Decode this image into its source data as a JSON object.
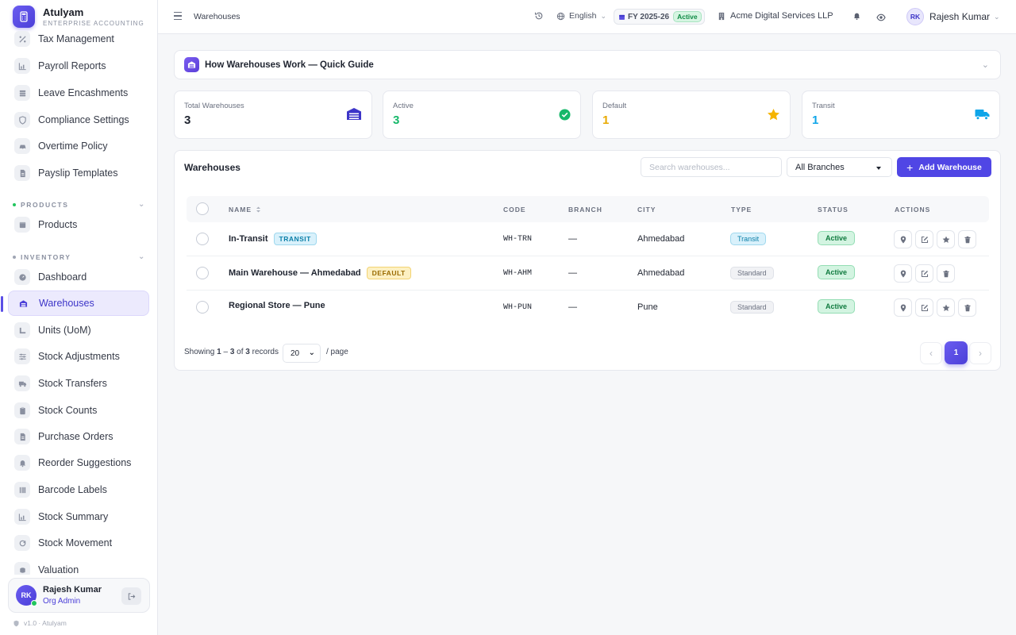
{
  "brand": {
    "name": "Atulyam",
    "subtitle": "ENTERPRISE ACCOUNTING"
  },
  "sidebar": {
    "items_top": [
      {
        "label": "Tax Management",
        "icon": "percent-icon"
      },
      {
        "label": "Payroll Reports",
        "icon": "chart-icon"
      },
      {
        "label": "Leave Encashments",
        "icon": "stack-icon"
      },
      {
        "label": "Compliance Settings",
        "icon": "shield-icon"
      },
      {
        "label": "Overtime Policy",
        "icon": "car-icon"
      },
      {
        "label": "Payslip Templates",
        "icon": "document-icon"
      }
    ],
    "section_products": {
      "label": "PRODUCTS",
      "dot_color": "#22c55e"
    },
    "products_items": [
      {
        "label": "Products",
        "icon": "box-icon"
      }
    ],
    "section_inventory": {
      "label": "INVENTORY",
      "dot_color": "#a0a6b4"
    },
    "inventory_items": [
      {
        "label": "Dashboard",
        "icon": "gauge-icon"
      },
      {
        "label": "Warehouses",
        "icon": "warehouse-icon",
        "active": true
      },
      {
        "label": "Units (UoM)",
        "icon": "ruler-icon"
      },
      {
        "label": "Stock Adjustments",
        "icon": "sliders-icon"
      },
      {
        "label": "Stock Transfers",
        "icon": "truck-icon"
      },
      {
        "label": "Stock Counts",
        "icon": "clipboard-icon"
      },
      {
        "label": "Purchase Orders",
        "icon": "document-icon"
      },
      {
        "label": "Reorder Suggestions",
        "icon": "bell-icon"
      },
      {
        "label": "Barcode Labels",
        "icon": "barcode-icon"
      },
      {
        "label": "Stock Summary",
        "icon": "chart-icon"
      },
      {
        "label": "Stock Movement",
        "icon": "cycle-icon"
      },
      {
        "label": "Valuation",
        "icon": "coins-icon"
      }
    ],
    "user": {
      "initials": "RK",
      "name": "Rajesh Kumar",
      "role": "Org Admin"
    },
    "version": "v1.0 · Atulyam"
  },
  "header": {
    "breadcrumb": "Warehouses",
    "language": "English",
    "fiscal_year": "FY 2025-26",
    "fiscal_status": "Active",
    "organization": "Acme Digital Services LLP",
    "user_initials": "RK",
    "user_name": "Rajesh Kumar"
  },
  "guide": {
    "title": "How Warehouses Work — Quick Guide"
  },
  "stats": [
    {
      "label": "Total Warehouses",
      "value": "3",
      "color": "#1f2430",
      "icon": "warehouse-icon"
    },
    {
      "label": "Active",
      "value": "3",
      "color": "#16b86a",
      "icon": "check-circle-icon"
    },
    {
      "label": "Default",
      "value": "1",
      "color": "#e8a900",
      "icon": "star-icon"
    },
    {
      "label": "Transit",
      "value": "1",
      "color": "#0ea5e9",
      "icon": "truck-icon"
    }
  ],
  "panel": {
    "title": "Warehouses",
    "search_placeholder": "Search warehouses...",
    "branch_filter": "All Branches",
    "add_button": "Add Warehouse"
  },
  "table": {
    "columns": [
      "NAME",
      "CODE",
      "BRANCH",
      "CITY",
      "TYPE",
      "STATUS",
      "ACTIONS"
    ],
    "rows": [
      {
        "name": "In-Transit",
        "tag": "TRANSIT",
        "code": "WH-TRN",
        "branch": "—",
        "city": "Ahmedabad",
        "type": "Transit",
        "status": "Active"
      },
      {
        "name": "Main Warehouse — Ahmedabad",
        "tag": "DEFAULT",
        "code": "WH-AHM",
        "branch": "—",
        "city": "Ahmedabad",
        "type": "Standard",
        "status": "Active"
      },
      {
        "name": "Regional Store — Pune",
        "tag": "",
        "code": "WH-PUN",
        "branch": "—",
        "city": "Pune",
        "type": "Standard",
        "status": "Active"
      }
    ]
  },
  "pagination": {
    "showing_prefix": "Showing",
    "range_start": "1",
    "range_sep": "–",
    "range_end": "3",
    "of": "of",
    "total": "3",
    "records": "records",
    "page_size": "20",
    "per_page": "/ page",
    "current_page": "1"
  }
}
